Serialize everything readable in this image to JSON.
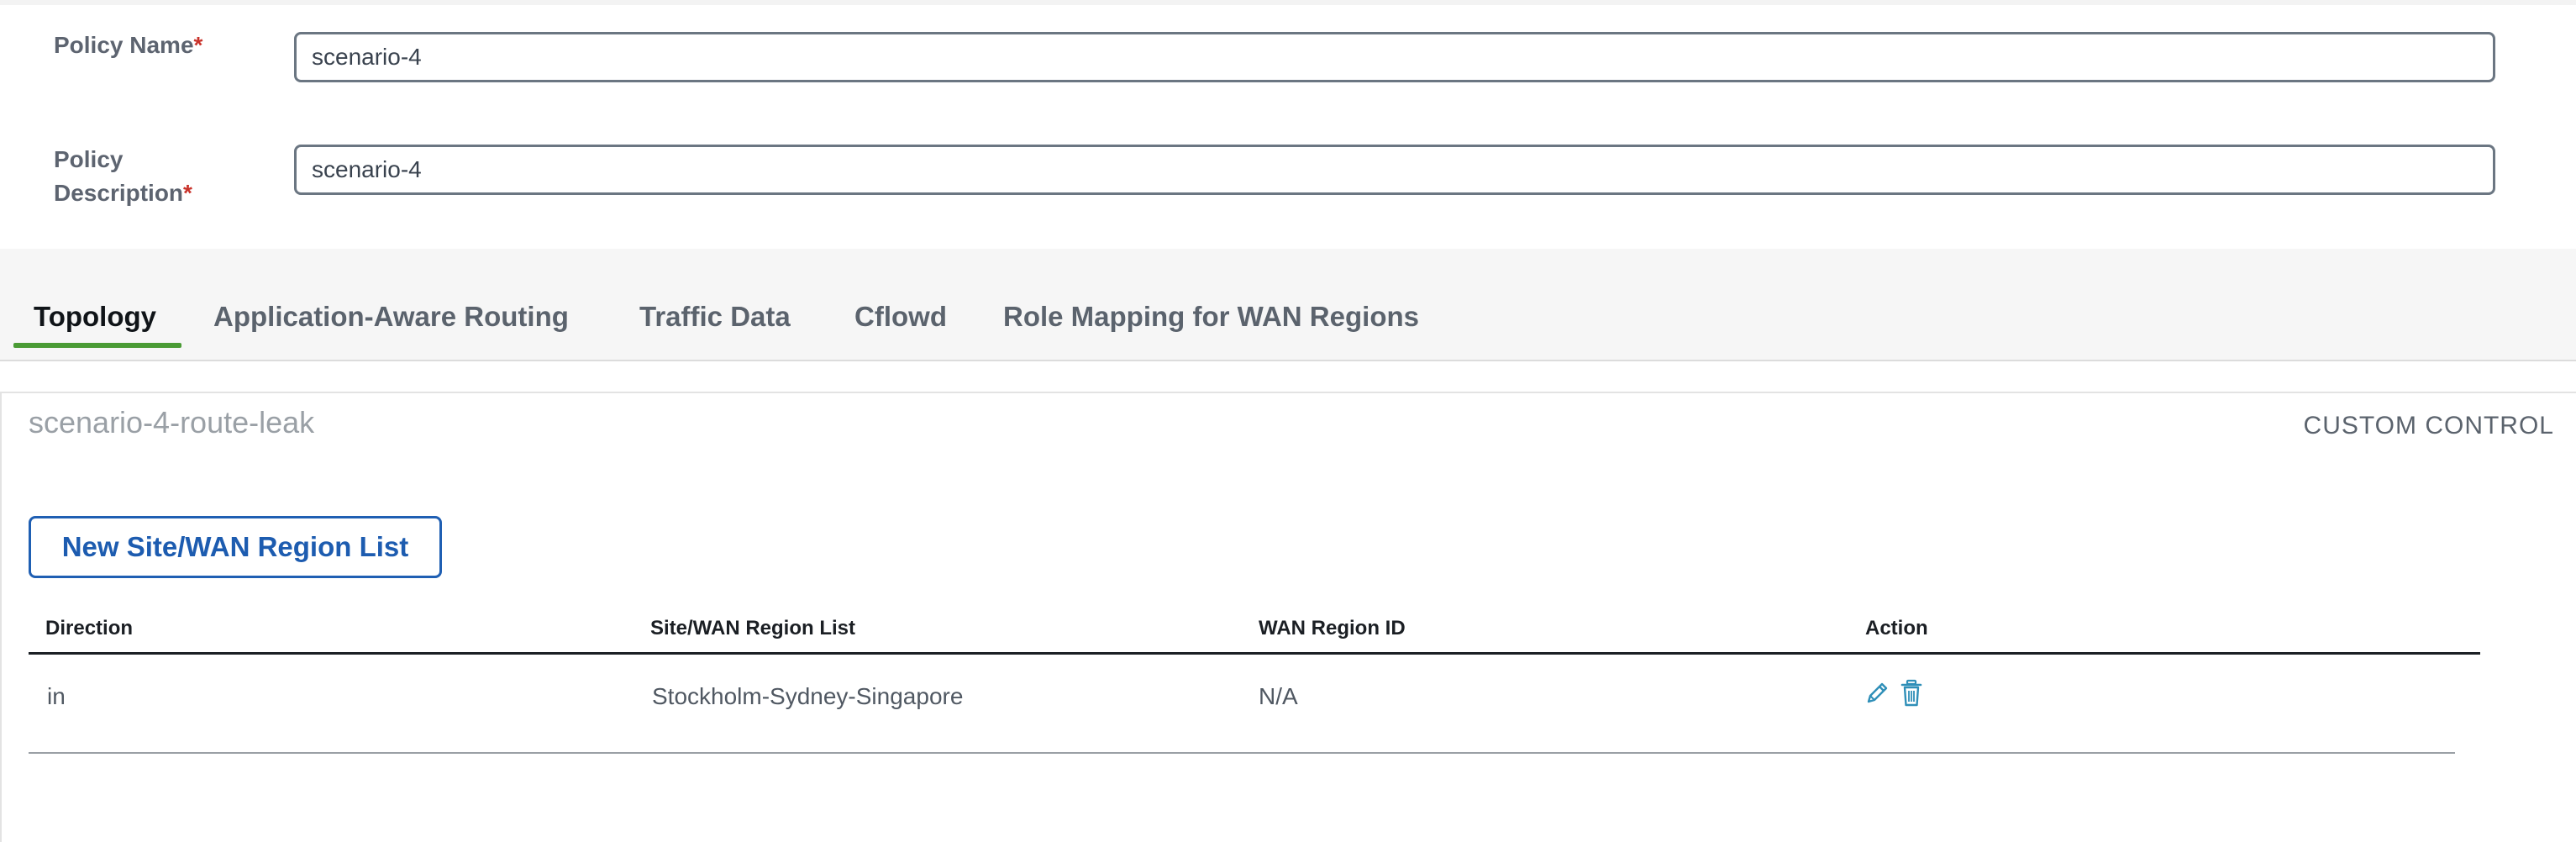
{
  "form": {
    "policy_name_label": "Policy Name",
    "policy_name_value": "scenario-4",
    "policy_description_label_line1": "Policy",
    "policy_description_label_line2": "Description",
    "policy_description_value": "scenario-4",
    "required_marker": "*"
  },
  "tabs": [
    {
      "label": "Topology",
      "active": true
    },
    {
      "label": "Application-Aware Routing",
      "active": false
    },
    {
      "label": "Traffic Data",
      "active": false
    },
    {
      "label": "Cflowd",
      "active": false
    },
    {
      "label": "Role Mapping for WAN Regions",
      "active": false
    }
  ],
  "panel": {
    "title": "scenario-4-route-leak",
    "type_label": "CUSTOM CONTROL",
    "new_list_button": "New Site/WAN Region List"
  },
  "table": {
    "columns": [
      "Direction",
      "Site/WAN Region List",
      "WAN Region ID",
      "Action"
    ],
    "rows": [
      {
        "direction": "in",
        "site_list": "Stockholm-Sydney-Singapore",
        "wan_region_id": "N/A",
        "actions": [
          "pencil-icon",
          "trash-icon"
        ]
      }
    ]
  },
  "colors": {
    "accent_green": "#4a9b35",
    "link_blue": "#1d5cb0",
    "required_red": "#c9332b",
    "icon_teal": "#2f8fb8"
  }
}
